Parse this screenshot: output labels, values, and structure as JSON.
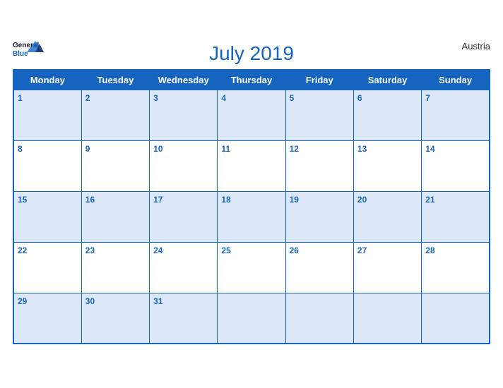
{
  "header": {
    "logo_line1": "General",
    "logo_line2": "Blue",
    "month_year": "July 2019",
    "country": "Austria"
  },
  "weekdays": [
    "Monday",
    "Tuesday",
    "Wednesday",
    "Thursday",
    "Friday",
    "Saturday",
    "Sunday"
  ],
  "weeks": [
    [
      1,
      2,
      3,
      4,
      5,
      6,
      7
    ],
    [
      8,
      9,
      10,
      11,
      12,
      13,
      14
    ],
    [
      15,
      16,
      17,
      18,
      19,
      20,
      21
    ],
    [
      22,
      23,
      24,
      25,
      26,
      27,
      28
    ],
    [
      29,
      30,
      31,
      null,
      null,
      null,
      null
    ]
  ]
}
